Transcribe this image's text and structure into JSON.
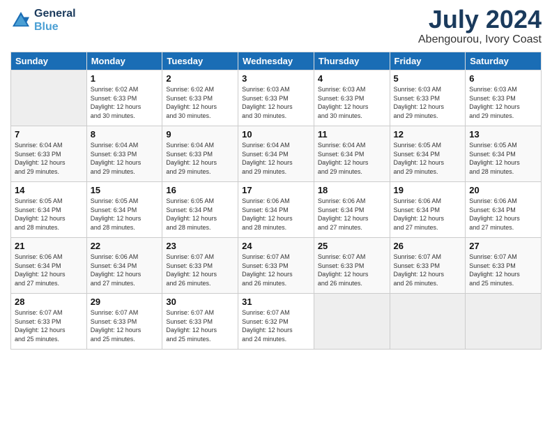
{
  "header": {
    "logo_line1": "General",
    "logo_line2": "Blue",
    "month_year": "July 2024",
    "location": "Abengourou, Ivory Coast"
  },
  "weekdays": [
    "Sunday",
    "Monday",
    "Tuesday",
    "Wednesday",
    "Thursday",
    "Friday",
    "Saturday"
  ],
  "weeks": [
    [
      {
        "day": "",
        "info": ""
      },
      {
        "day": "1",
        "info": "Sunrise: 6:02 AM\nSunset: 6:33 PM\nDaylight: 12 hours\nand 30 minutes."
      },
      {
        "day": "2",
        "info": "Sunrise: 6:02 AM\nSunset: 6:33 PM\nDaylight: 12 hours\nand 30 minutes."
      },
      {
        "day": "3",
        "info": "Sunrise: 6:03 AM\nSunset: 6:33 PM\nDaylight: 12 hours\nand 30 minutes."
      },
      {
        "day": "4",
        "info": "Sunrise: 6:03 AM\nSunset: 6:33 PM\nDaylight: 12 hours\nand 30 minutes."
      },
      {
        "day": "5",
        "info": "Sunrise: 6:03 AM\nSunset: 6:33 PM\nDaylight: 12 hours\nand 29 minutes."
      },
      {
        "day": "6",
        "info": "Sunrise: 6:03 AM\nSunset: 6:33 PM\nDaylight: 12 hours\nand 29 minutes."
      }
    ],
    [
      {
        "day": "7",
        "info": "Sunrise: 6:04 AM\nSunset: 6:33 PM\nDaylight: 12 hours\nand 29 minutes."
      },
      {
        "day": "8",
        "info": "Sunrise: 6:04 AM\nSunset: 6:33 PM\nDaylight: 12 hours\nand 29 minutes."
      },
      {
        "day": "9",
        "info": "Sunrise: 6:04 AM\nSunset: 6:33 PM\nDaylight: 12 hours\nand 29 minutes."
      },
      {
        "day": "10",
        "info": "Sunrise: 6:04 AM\nSunset: 6:34 PM\nDaylight: 12 hours\nand 29 minutes."
      },
      {
        "day": "11",
        "info": "Sunrise: 6:04 AM\nSunset: 6:34 PM\nDaylight: 12 hours\nand 29 minutes."
      },
      {
        "day": "12",
        "info": "Sunrise: 6:05 AM\nSunset: 6:34 PM\nDaylight: 12 hours\nand 29 minutes."
      },
      {
        "day": "13",
        "info": "Sunrise: 6:05 AM\nSunset: 6:34 PM\nDaylight: 12 hours\nand 28 minutes."
      }
    ],
    [
      {
        "day": "14",
        "info": "Sunrise: 6:05 AM\nSunset: 6:34 PM\nDaylight: 12 hours\nand 28 minutes."
      },
      {
        "day": "15",
        "info": "Sunrise: 6:05 AM\nSunset: 6:34 PM\nDaylight: 12 hours\nand 28 minutes."
      },
      {
        "day": "16",
        "info": "Sunrise: 6:05 AM\nSunset: 6:34 PM\nDaylight: 12 hours\nand 28 minutes."
      },
      {
        "day": "17",
        "info": "Sunrise: 6:06 AM\nSunset: 6:34 PM\nDaylight: 12 hours\nand 28 minutes."
      },
      {
        "day": "18",
        "info": "Sunrise: 6:06 AM\nSunset: 6:34 PM\nDaylight: 12 hours\nand 27 minutes."
      },
      {
        "day": "19",
        "info": "Sunrise: 6:06 AM\nSunset: 6:34 PM\nDaylight: 12 hours\nand 27 minutes."
      },
      {
        "day": "20",
        "info": "Sunrise: 6:06 AM\nSunset: 6:34 PM\nDaylight: 12 hours\nand 27 minutes."
      }
    ],
    [
      {
        "day": "21",
        "info": "Sunrise: 6:06 AM\nSunset: 6:34 PM\nDaylight: 12 hours\nand 27 minutes."
      },
      {
        "day": "22",
        "info": "Sunrise: 6:06 AM\nSunset: 6:34 PM\nDaylight: 12 hours\nand 27 minutes."
      },
      {
        "day": "23",
        "info": "Sunrise: 6:07 AM\nSunset: 6:33 PM\nDaylight: 12 hours\nand 26 minutes."
      },
      {
        "day": "24",
        "info": "Sunrise: 6:07 AM\nSunset: 6:33 PM\nDaylight: 12 hours\nand 26 minutes."
      },
      {
        "day": "25",
        "info": "Sunrise: 6:07 AM\nSunset: 6:33 PM\nDaylight: 12 hours\nand 26 minutes."
      },
      {
        "day": "26",
        "info": "Sunrise: 6:07 AM\nSunset: 6:33 PM\nDaylight: 12 hours\nand 26 minutes."
      },
      {
        "day": "27",
        "info": "Sunrise: 6:07 AM\nSunset: 6:33 PM\nDaylight: 12 hours\nand 25 minutes."
      }
    ],
    [
      {
        "day": "28",
        "info": "Sunrise: 6:07 AM\nSunset: 6:33 PM\nDaylight: 12 hours\nand 25 minutes."
      },
      {
        "day": "29",
        "info": "Sunrise: 6:07 AM\nSunset: 6:33 PM\nDaylight: 12 hours\nand 25 minutes."
      },
      {
        "day": "30",
        "info": "Sunrise: 6:07 AM\nSunset: 6:33 PM\nDaylight: 12 hours\nand 25 minutes."
      },
      {
        "day": "31",
        "info": "Sunrise: 6:07 AM\nSunset: 6:32 PM\nDaylight: 12 hours\nand 24 minutes."
      },
      {
        "day": "",
        "info": ""
      },
      {
        "day": "",
        "info": ""
      },
      {
        "day": "",
        "info": ""
      }
    ]
  ]
}
